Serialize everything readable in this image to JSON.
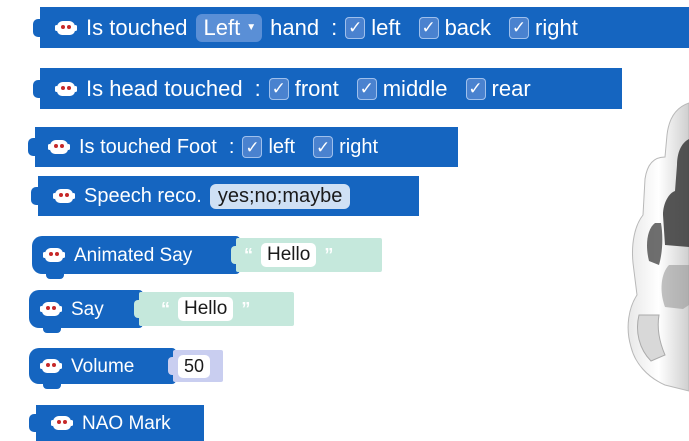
{
  "colors": {
    "block": "#1565c0",
    "text_input": "#c5e8dc",
    "number_input": "#c9cef0"
  },
  "blocks": [
    {
      "label": "Is touched",
      "dropdown": "Left",
      "suffix": "hand",
      "colon": ":",
      "options": [
        "left",
        "back",
        "right"
      ]
    },
    {
      "label": "Is head touched",
      "colon": ":",
      "options": [
        "front",
        "middle",
        "rear"
      ]
    },
    {
      "label": "Is touched Foot",
      "colon": ":",
      "options": [
        "left",
        "right"
      ]
    },
    {
      "label": "Speech reco.",
      "field": "yes;no;maybe"
    },
    {
      "label": "Animated Say",
      "text": "Hello"
    },
    {
      "label": "Say",
      "text": "Hello"
    },
    {
      "label": "Volume",
      "number": "50"
    },
    {
      "label": "NAO Mark"
    }
  ],
  "check_glyph": "✓",
  "quote_open": "“",
  "quote_close": "”",
  "icon": "nao-robot-icon",
  "image": "nao-robot-photo"
}
